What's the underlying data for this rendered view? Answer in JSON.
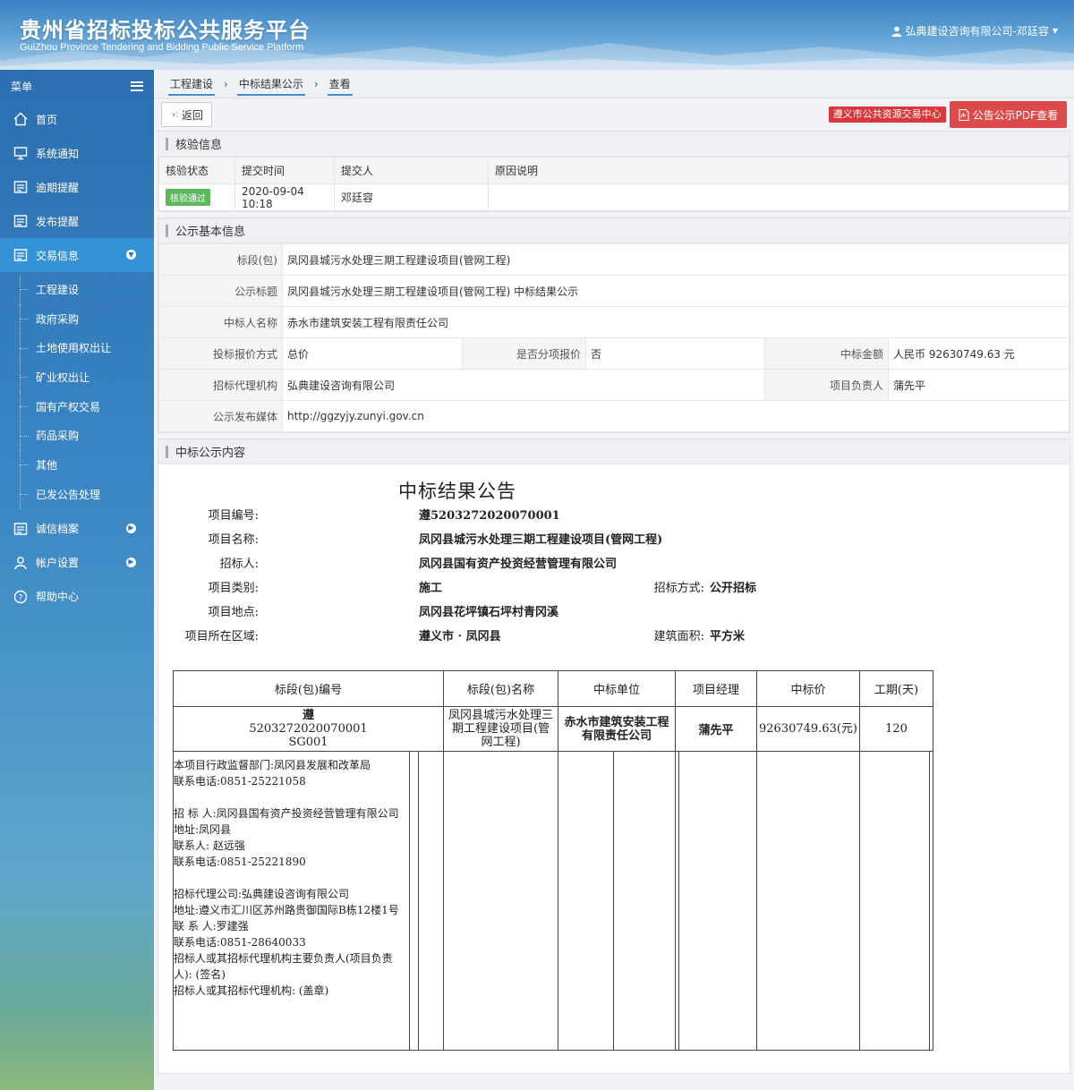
{
  "header": {
    "title": "贵州省招标投标公共服务平台",
    "subtitle": "GuiZhou Province Tendering and Bidding Public Service Platform",
    "user": "弘典建设咨询有限公司-邓廷容"
  },
  "sidebar": {
    "menu_label": "菜单",
    "items": [
      {
        "label": "首页",
        "icon": "home-icon"
      },
      {
        "label": "系统通知",
        "icon": "monitor-icon"
      },
      {
        "label": "逾期提醒",
        "icon": "list-icon"
      },
      {
        "label": "发布提醒",
        "icon": "list-icon"
      },
      {
        "label": "交易信息",
        "icon": "list-icon"
      }
    ],
    "subitems": [
      "工程建设",
      "政府采购",
      "土地使用权出让",
      "矿业权出让",
      "国有产权交易",
      "药品采购",
      "其他",
      "已发公告处理"
    ],
    "bottom_items": [
      {
        "label": "诚信档案",
        "icon": "list-icon"
      },
      {
        "label": "帐户设置",
        "icon": "user-icon"
      },
      {
        "label": "帮助中心",
        "icon": "help-icon"
      }
    ]
  },
  "breadcrumb": [
    "工程建设",
    "中标结果公示",
    "查看"
  ],
  "toolbar": {
    "back_label": "返回",
    "center_tag": "遵义市公共资源交易中心",
    "pdf_label": "公告公示PDF查看"
  },
  "verify": {
    "title": "核验信息",
    "headers": [
      "核验状态",
      "提交时间",
      "提交人",
      "原因说明"
    ],
    "status": "核验通过",
    "time": "2020-09-04 10:18",
    "submitter": "邓廷容",
    "reason": ""
  },
  "basic": {
    "title": "公示基本信息",
    "section_label": "标段(包)",
    "section_value": "凤冈县城污水处理三期工程建设项目(管网工程)",
    "notice_title_label": "公示标题",
    "notice_title_value": "凤冈县城污水处理三期工程建设项目(管网工程) 中标结果公示",
    "winner_label": "中标人名称",
    "winner_value": "赤水市建筑安装工程有限责任公司",
    "quote_label": "投标报价方式",
    "quote_value": "总价",
    "split_label": "是否分项报价",
    "split_value": "否",
    "amount_label": "中标金额",
    "amount_value": "人民币 92630749.63 元",
    "agency_label": "招标代理机构",
    "agency_value": "弘典建设咨询有限公司",
    "manager_label": "项目负责人",
    "manager_value": "蒲先平",
    "media_label": "公示发布媒体",
    "media_value": "http://ggzyjy.zunyi.gov.cn"
  },
  "content": {
    "title": "中标公示内容",
    "notice_heading": "中标结果公告",
    "fields": {
      "code_label": "项目编号:",
      "code_value": "遵5203272020070001",
      "name_label": "项目名称:",
      "name_value": "凤冈县城污水处理三期工程建设项目(管网工程)",
      "tenderer_label": "招标人:",
      "tenderer_value": "凤冈县国有资产投资经营管理有限公司",
      "type_label": "项目类别:",
      "type_value": "施工",
      "method_label": "招标方式:",
      "method_value": "公开招标",
      "location_label": "项目地点:",
      "location_value": "凤冈县花坪镇石坪村青冈溪",
      "region_label": "项目所在区域:",
      "region_value": "遵义市 · 凤冈县",
      "area_label": "建筑面积:",
      "area_value": "平方米"
    },
    "table": {
      "headers": [
        "标段(包)编号",
        "标段(包)名称",
        "中标单位",
        "项目经理",
        "中标价",
        "工期(天)"
      ],
      "row": {
        "code_line1": "遵",
        "code_line2": "5203272020070001",
        "code_line3": "SG001",
        "name": "凤冈县城污水处理三期工程建设项目(管网工程)",
        "unit": "赤水市建筑安装工程有限责任公司",
        "manager": "蒲先平",
        "price": "92630749.63(元)",
        "days": "120"
      },
      "footer_lines": [
        "本项目行政监督部门:凤冈县发展和改革局",
        "联系电话:0851-25221058",
        "",
        "招  标  人:凤冈县国有资产投资经营管理有限公司",
        "地址:凤冈县",
        "联系人:  赵远强",
        "联系电话:0851-25221890",
        "",
        "招标代理公司:弘典建设咨询有限公司",
        "地址:遵义市汇川区苏州路贵御国际B栋12楼1号",
        "联  系  人:罗建强",
        "联系电话:0851-28640033",
        "招标人或其招标代理机构主要负责人(项目负责人): (签名)",
        "招标人或其招标代理机构:  (盖章)"
      ]
    }
  }
}
